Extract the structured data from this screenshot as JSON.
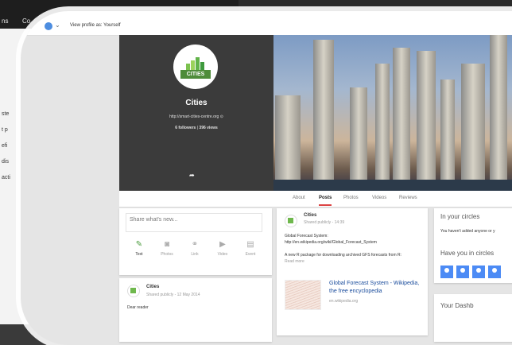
{
  "background": {
    "menu_fragment_1": "ns",
    "menu_fragment_2": "Co",
    "list_fragments": [
      "ste",
      "t p",
      "efi",
      "dis",
      "acti"
    ]
  },
  "topbar": {
    "view_profile_label": "View profile as: Yourself"
  },
  "profile": {
    "name": "Cities",
    "logo_text": "CITIES",
    "url": "http://smart-cities-centre.org",
    "followers": "6 followers",
    "views": "396 views"
  },
  "tabs": [
    "About",
    "Posts",
    "Photos",
    "Videos",
    "Reviews"
  ],
  "active_tab": "Posts",
  "share": {
    "placeholder": "Share what's new...",
    "actions": [
      "Text",
      "Photos",
      "Link",
      "Video",
      "Event"
    ]
  },
  "post1": {
    "author": "Cities",
    "meta": "Shared publicly - 14:39",
    "title": "Global Forecast System:",
    "link": "http://en.wikipedia.org/wiki/Global_Forecast_System",
    "body": "A new R package for downloading archived GFS forecasts from R:",
    "read_more": "Read more",
    "link_title": "Global Forecast System - Wikipedia, the free encyclopedia",
    "link_domain": "en.wikipedia.org"
  },
  "post2": {
    "author": "Cities",
    "meta": "Shared publicly - 12 May 2014",
    "body": "Dear reader"
  },
  "sidebar": {
    "in_circles_title": "In your circles",
    "in_circles_text": "You haven't added anyone or y",
    "have_you_title": "Have you in circles",
    "dashboard_title": "Your Dashb"
  },
  "colors": {
    "accent": "#4a9b3d",
    "tab_underline": "#dd4444",
    "link": "#1a4c9c"
  }
}
